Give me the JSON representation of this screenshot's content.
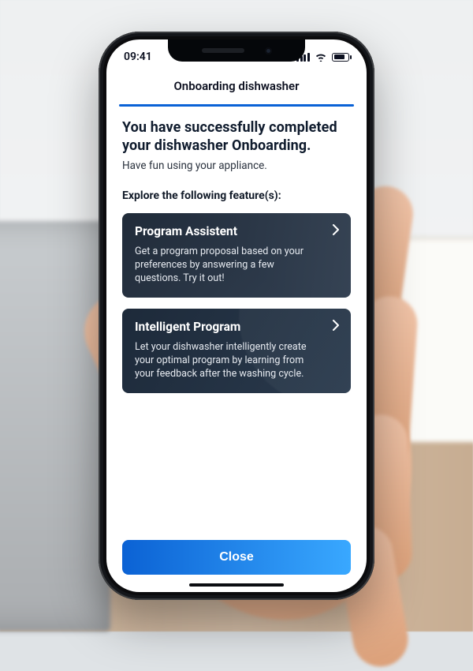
{
  "status_bar": {
    "time": "09:41"
  },
  "header": {
    "title": "Onboarding dishwasher",
    "progress_percent": 100
  },
  "main": {
    "title": "You have successfully completed your dishwasher Onboarding.",
    "subtitle": "Have fun using your appliance.",
    "explore_label": "Explore the following feature(s):",
    "cards": [
      {
        "title": "Program Assistent",
        "description": "Get a program proposal based on your preferences by answering a few questions. Try it out!"
      },
      {
        "title": "Intelligent Program",
        "description": "Let your dishwasher intelligently create your optimal program by learning from your feedback after the washing cycle."
      }
    ]
  },
  "footer": {
    "close_label": "Close"
  },
  "colors": {
    "accent": "#0a62d6",
    "button_gradient_start": "#0b62d4",
    "button_gradient_end": "#39a8ff"
  }
}
